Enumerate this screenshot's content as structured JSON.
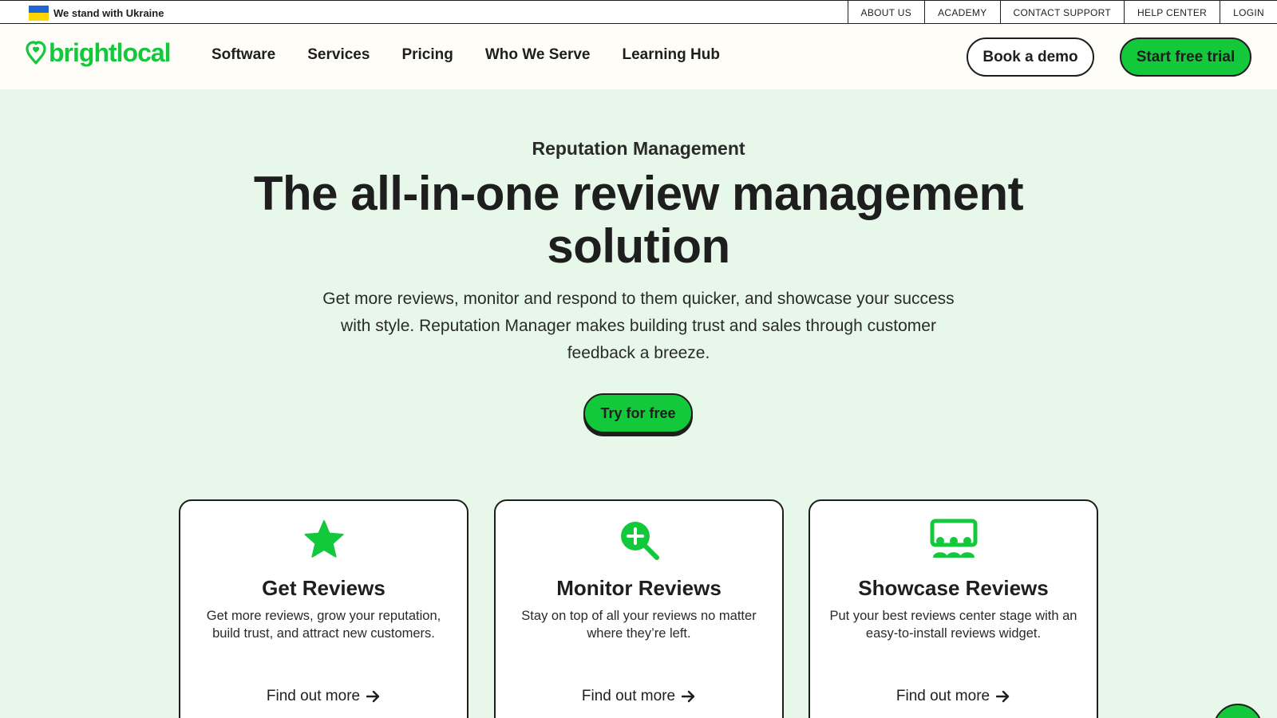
{
  "topbar": {
    "ukraine_label": "We stand with Ukraine",
    "links": [
      "ABOUT US",
      "ACADEMY",
      "CONTACT SUPPORT",
      "HELP CENTER",
      "LOGIN"
    ]
  },
  "header": {
    "logo_text": "brightlocal",
    "nav": [
      "Software",
      "Services",
      "Pricing",
      "Who We Serve",
      "Learning Hub"
    ],
    "demo_label": "Book a demo",
    "trial_label": "Start free trial"
  },
  "hero": {
    "eyebrow": "Reputation Management",
    "title": "The all-in-one review management solution",
    "description": "Get more reviews, monitor and respond to them quicker, and showcase your success with style. Reputation Manager makes building trust and sales through customer feedback a breeze.",
    "cta_label": "Try for free"
  },
  "cards": [
    {
      "icon": "star-icon",
      "title": "Get Reviews",
      "description": "Get more reviews, grow your reputation, build trust, and attract new customers.",
      "link": "Find out more"
    },
    {
      "icon": "magnifier-plus-icon",
      "title": "Monitor Reviews",
      "description": "Stay on top of all your reviews no matter where they’re left.",
      "link": "Find out more"
    },
    {
      "icon": "audience-screen-icon",
      "title": "Showcase Reviews",
      "description": "Put your best reviews center stage with an easy-to-install reviews widget.",
      "link": "Find out more"
    }
  ],
  "colors": {
    "brand_green": "#14c83c",
    "hero_background": "#e7f8ea",
    "text_dark": "#1e1e1e",
    "ukraine_blue": "#1f66d1",
    "ukraine_yellow": "#ffd400"
  }
}
